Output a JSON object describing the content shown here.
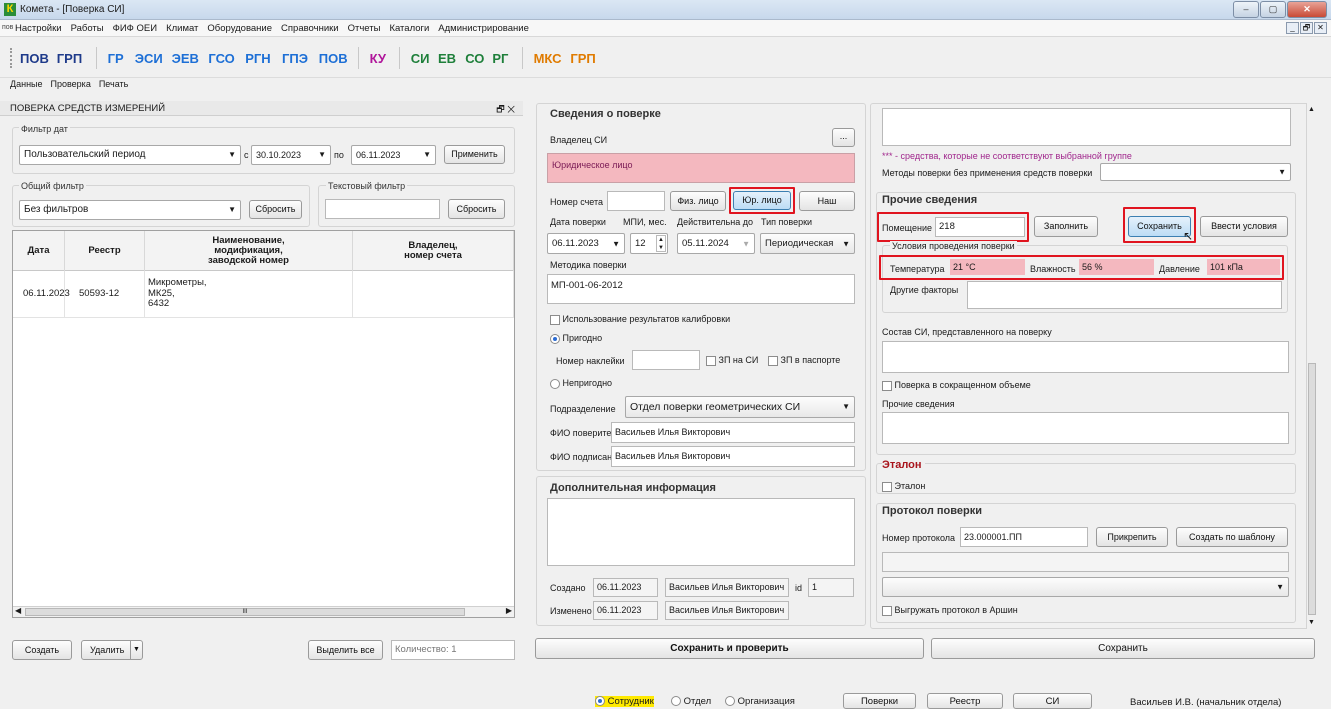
{
  "window": {
    "title": "Комета - [Поверка СИ]",
    "logo": "К"
  },
  "menu": {
    "prefix": "пов",
    "items": [
      "Настройки",
      "Работы",
      "ФИФ ОЕИ",
      "Климат",
      "Оборудование",
      "Справочники",
      "Отчеты",
      "Каталоги",
      "Администрирование"
    ]
  },
  "toolbar": {
    "groups": [
      [
        {
          "label": "ПОВ",
          "color": "#1e3a8a"
        },
        {
          "label": "ГРП",
          "color": "#1e3a8a"
        }
      ],
      [
        {
          "label": "ГР",
          "color": "#1d6fd6"
        },
        {
          "label": "ЭСИ",
          "color": "#1d6fd6"
        },
        {
          "label": "ЭЕВ",
          "color": "#1d6fd6"
        },
        {
          "label": "ГСО",
          "color": "#1d6fd6"
        },
        {
          "label": "РГН",
          "color": "#1d6fd6"
        },
        {
          "label": "ГПЭ",
          "color": "#1d6fd6"
        },
        {
          "label": "ПОВ",
          "color": "#1d6fd6"
        }
      ],
      [
        {
          "label": "КУ",
          "color": "#b0159a"
        }
      ],
      [
        {
          "label": "СИ",
          "color": "#1e7f3a"
        },
        {
          "label": "ЕВ",
          "color": "#1e7f3a"
        },
        {
          "label": "СО",
          "color": "#1e7f3a"
        },
        {
          "label": "РГ",
          "color": "#1e7f3a"
        }
      ],
      [
        {
          "label": "МКС",
          "color": "#e07b00"
        },
        {
          "label": "ГРП",
          "color": "#e07b00"
        }
      ]
    ]
  },
  "subtabs": [
    "Данные",
    "Проверка",
    "Печать"
  ],
  "left_panel": {
    "title": "ПОВЕРКА СРЕДСТВ ИЗМЕРЕНИЙ",
    "panel_controls": "🗗 ✕",
    "date_filter": {
      "label": "Фильтр дат",
      "period": "Пользовательский период",
      "from_label": "с",
      "from": "30.10.2023",
      "to_label": "по",
      "to": "06.11.2023",
      "apply": "Применить"
    },
    "common_filter": {
      "label": "Общий фильтр",
      "value": "Без фильтров",
      "reset": "Сбросить"
    },
    "text_filter": {
      "label": "Текстовый фильтр",
      "value": "",
      "reset": "Сбросить"
    },
    "table": {
      "headers": [
        "Дата",
        "Реестр",
        "Наименование, модификация, заводской номер",
        "Владелец, номер счета"
      ],
      "rows": [
        {
          "date": "06.11.2023",
          "reg": "50593-12",
          "name_lines": [
            "Микрометры,",
            "МК25,",
            "6432"
          ],
          "owner": ""
        }
      ]
    },
    "scroll_mark": "III",
    "create": "Создать",
    "delete": "Удалить",
    "select_all": "Выделить все",
    "count": "Количество: 1"
  },
  "mid_panel": {
    "section_title": "Сведения о поверке",
    "owner_label": "Владелец СИ",
    "owner_btn": "...",
    "owner_value": "Юридическое лицо",
    "account_label": "Номер счета",
    "account_value": "",
    "fiz": "Физ. лицо",
    "yur": "Юр. лицо",
    "nash": "Наш",
    "date_label": "Дата поверки",
    "mpi_label": "МПИ, мес.",
    "valid_label": "Действительна до",
    "type_label": "Тип поверки",
    "date_value": "06.11.2023",
    "mpi_value": "12",
    "valid_value": "05.11.2024",
    "type_value": "Периодическая",
    "method_label": "Методика поверки",
    "method_value": "МП-001-06-2012",
    "calib_label": "Использование результатов калибровки",
    "fit_label": "Пригодно",
    "sticker_label": "Номер наклейки",
    "sticker_value": "",
    "zp_si": "ЗП на СИ",
    "zp_pasp": "ЗП в паспорте",
    "unfit_label": "Непригодно",
    "dept_label": "Подразделение",
    "dept_value": "Отдел поверки геометрических СИ",
    "verifier_label": "ФИО поверителя",
    "verifier_value": "Васильев Илья Викторович",
    "signer_label": "ФИО подписанта",
    "signer_value": "Васильев Илья Викторович",
    "add_info_title": "Дополнительная информация",
    "created_label": "Создано",
    "created_date": "06.11.2023",
    "created_by": "Васильев Илья Викторович",
    "id_label": "id",
    "id_value": "1",
    "changed_label": "Изменено",
    "changed_date": "06.11.2023",
    "changed_by": "Васильев Илья Викторович"
  },
  "right_panel": {
    "note": "*** - средства, которые не соответствуют выбранной группе",
    "methods_label": "Методы поверки без применения средств поверки",
    "other_title": "Прочие сведения",
    "room_label": "Помещение",
    "room_value": "218",
    "fill": "Заполнить",
    "save": "Сохранить",
    "enter_cond": "Ввести условия",
    "cond_label": "Условия проведения поверки",
    "temp_label": "Температура",
    "temp_value": "21 °C",
    "hum_label": "Влажность",
    "hum_value": "56 %",
    "press_label": "Давление",
    "press_value": "101 кПа",
    "other_factors": "Другие факторы",
    "composition_label": "Состав СИ, представленного на поверку",
    "reduced_label": "Поверка в сокращенном объеме",
    "other_info_label": "Прочие сведения",
    "etalon_title": "Эталон",
    "etalon_chk": "Эталон",
    "protocol_title": "Протокол поверки",
    "protocol_label": "Номер протокола",
    "protocol_value": "23.000001.ПП",
    "attach": "Прикрепить",
    "template": "Создать по шаблону",
    "arshin": "Выгружать протокол в Аршин"
  },
  "bottom": {
    "save_check": "Сохранить и проверить",
    "save": "Сохранить"
  },
  "status": {
    "employee": "Сотрудник",
    "dept": "Отдел",
    "org": "Организация",
    "checks": "Поверки",
    "registry": "Реестр",
    "si": "СИ",
    "user": "Васильев И.В. (начальник отдела)"
  }
}
